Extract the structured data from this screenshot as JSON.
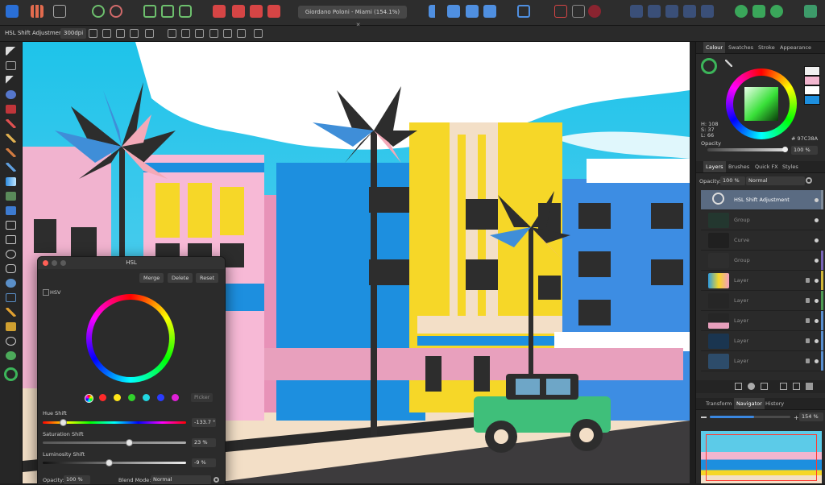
{
  "document": {
    "title": "Giordano Poloni - Miami (154.1%)",
    "close": "✕"
  },
  "context": {
    "label": "HSL Shift Adjustment",
    "dpi": "300dpi"
  },
  "colour_panel": {
    "tabs": [
      "Colour",
      "Swatches",
      "Stroke",
      "Appearance"
    ],
    "h": "H: 108",
    "s": "S: 37",
    "l": "L: 66",
    "hex": "97C38A",
    "opacity_label": "Opacity",
    "opacity_value": "100 %"
  },
  "layers_panel": {
    "tabs": [
      "Layers",
      "Brushes",
      "Quick FX",
      "Styles"
    ],
    "opacity_label": "Opacity:",
    "opacity_value": "100 %",
    "blend": "Normal",
    "layers": [
      {
        "name": "HSL Shift Adjustment",
        "color": "#7f8b99"
      },
      {
        "name": "Group",
        "color": ""
      },
      {
        "name": "Curve",
        "color": ""
      },
      {
        "name": "Group",
        "color": "#7a66b8"
      },
      {
        "name": "Layer",
        "color": "#d1b83a"
      },
      {
        "name": "Layer",
        "color": "#4f9b55"
      },
      {
        "name": "Layer",
        "color": "#5a8fd0"
      },
      {
        "name": "Layer",
        "color": "#5a8fd0"
      },
      {
        "name": "Layer",
        "color": "#5a8fd0"
      }
    ]
  },
  "navigator_panel": {
    "tabs": [
      "Transform",
      "Navigator",
      "History"
    ],
    "zoom": "154 %",
    "zoom_fraction": 0.55
  },
  "hsl_dialog": {
    "title": "HSL",
    "buttons": [
      "Merge",
      "Delete",
      "Reset"
    ],
    "hsv_label": "HSV",
    "picker": "Picker",
    "hue_label": "Hue Shift",
    "hue_value": "-133.7 °",
    "hue_fraction": 0.14,
    "sat_label": "Saturation Shift",
    "sat_value": "23 %",
    "sat_fraction": 0.6,
    "lum_label": "Luminosity Shift",
    "lum_value": "-9 %",
    "lum_fraction": 0.46,
    "opacity_label": "Opacity:",
    "opacity_value": "100 %",
    "blend_label": "Blend Mode:",
    "blend_value": "Normal",
    "swatch_colors": [
      "#ff2a2a",
      "#ffe61a",
      "#31d12c",
      "#22d6e0",
      "#2a3cff",
      "#e020d8"
    ]
  }
}
